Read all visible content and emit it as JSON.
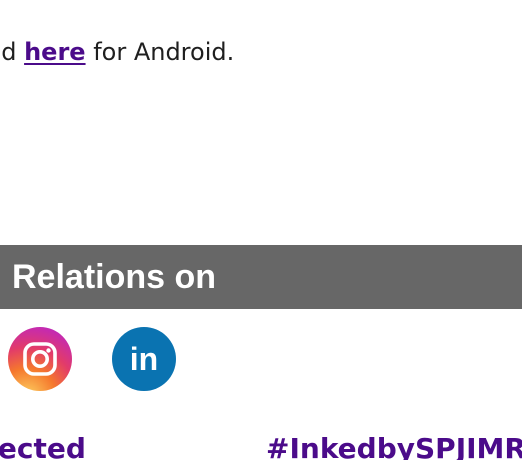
{
  "app_download": {
    "prefix": "nd ",
    "link_label": "here",
    "suffix": " for Android."
  },
  "section_bar": {
    "title": "Relations on"
  },
  "social": {
    "instagram_icon": "instagram-icon",
    "linkedin_icon": "linkedin-icon",
    "linkedin_text": "in"
  },
  "bottom": {
    "left_text": "nected",
    "right_text": "#InkedbySPJIMR"
  },
  "colors": {
    "link": "#4b0b8a",
    "bar": "#676767",
    "linkedin": "#0a73b1"
  }
}
